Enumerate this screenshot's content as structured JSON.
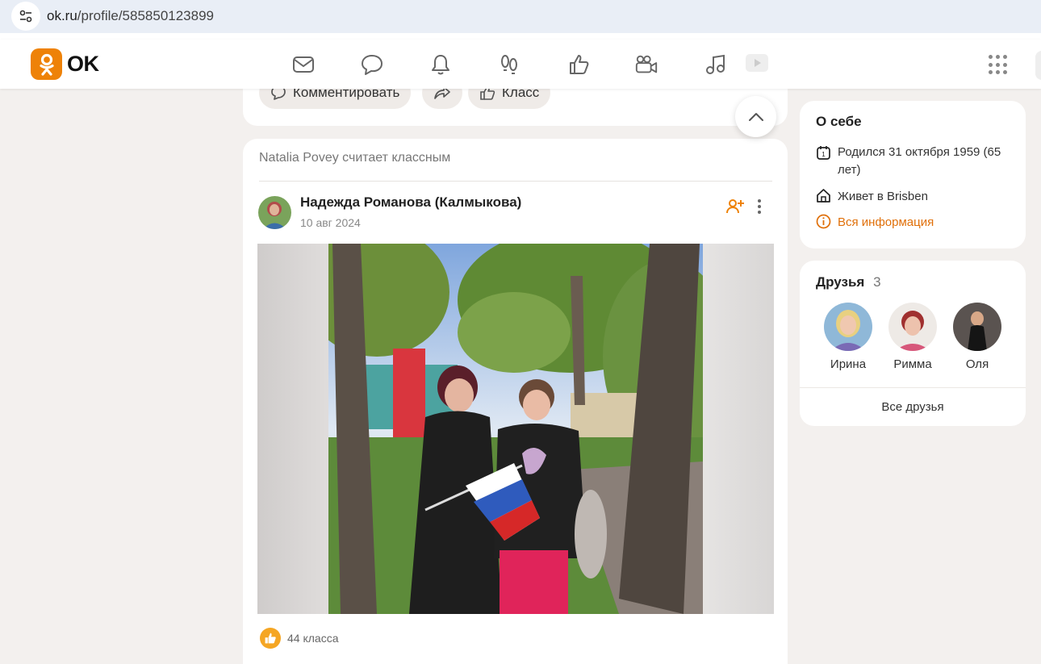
{
  "browser": {
    "url_host": "ok.ru",
    "url_path": "/profile/585850123899"
  },
  "topnav": {
    "logo_text": "OK",
    "icons": [
      "mail-icon",
      "chat-icon",
      "bell-icon",
      "footprints-icon",
      "thumb-up-icon",
      "video-camera-icon",
      "music-icon",
      "video-play-icon",
      "apps-grid-icon"
    ]
  },
  "prev_post": {
    "comment_label": "Комментировать",
    "klass_label": "Класс"
  },
  "post": {
    "liked_by": "Natalia Povey считает классным",
    "author": "Надежда Романова (Калмыкова)",
    "date": "10 авг 2024",
    "likes": "44 класса"
  },
  "about": {
    "title": "О себе",
    "born": "Родился 31 октября 1959 (65 лет)",
    "lives": "Живет в Brisben",
    "all_info": "Вся информация"
  },
  "friends": {
    "title": "Друзья",
    "count": "3",
    "items": [
      {
        "name": "Ирина"
      },
      {
        "name": "Римма"
      },
      {
        "name": "Оля"
      }
    ],
    "all_label": "Все друзья"
  },
  "colors": {
    "accent": "#ee8208",
    "link": "#e0700a",
    "page_bg": "#f3f0ee"
  }
}
